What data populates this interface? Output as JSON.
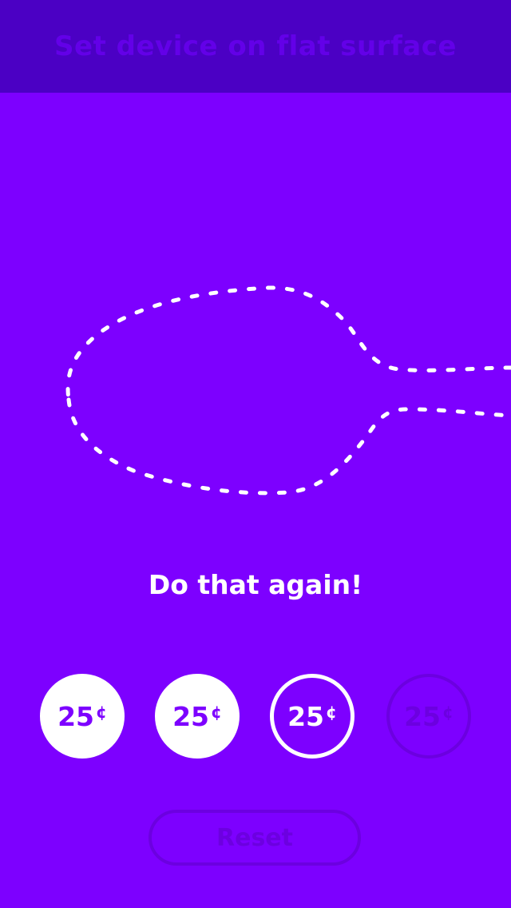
{
  "header": {
    "title": "Set device on flat surface"
  },
  "message": "Do that again!",
  "coins": [
    {
      "amount": "25",
      "symbol": "¢",
      "state": "filled"
    },
    {
      "amount": "25",
      "symbol": "¢",
      "state": "filled"
    },
    {
      "amount": "25",
      "symbol": "¢",
      "state": "active"
    },
    {
      "amount": "25",
      "symbol": "¢",
      "state": "inactive"
    }
  ],
  "reset_label": "Reset",
  "colors": {
    "background": "#7d00ff",
    "header": "#4b00c4",
    "dim": "#6c00e0",
    "white": "#ffffff"
  }
}
